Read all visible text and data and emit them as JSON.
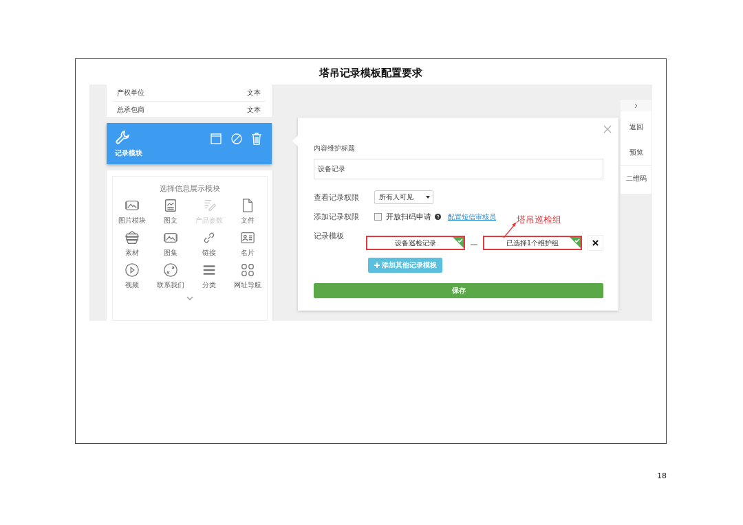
{
  "document": {
    "title": "塔吊记录模板配置要求",
    "page_number": "18"
  },
  "field_list": [
    {
      "name": "产权单位",
      "type": "文本"
    },
    {
      "name": "总承包商",
      "type": "文本"
    }
  ],
  "active_module": {
    "label": "记录模块"
  },
  "module_picker": {
    "title": "选择信息展示模块",
    "items": [
      {
        "label": "图片模块",
        "kind": "image",
        "disabled": false
      },
      {
        "label": "图文",
        "kind": "article",
        "disabled": false
      },
      {
        "label": "产品参数",
        "kind": "edit",
        "disabled": true
      },
      {
        "label": "文件",
        "kind": "file",
        "disabled": false
      },
      {
        "label": "素材",
        "kind": "layers",
        "disabled": false
      },
      {
        "label": "图集",
        "kind": "image",
        "disabled": false
      },
      {
        "label": "链接",
        "kind": "link",
        "disabled": false
      },
      {
        "label": "名片",
        "kind": "card",
        "disabled": false
      },
      {
        "label": "视频",
        "kind": "video",
        "disabled": false
      },
      {
        "label": "联系我们",
        "kind": "contact",
        "disabled": false
      },
      {
        "label": "分类",
        "kind": "list",
        "disabled": false
      },
      {
        "label": "网址导航",
        "kind": "grid",
        "disabled": false
      }
    ]
  },
  "dialog": {
    "title_label": "内容维护标题",
    "title_value": "设备记录",
    "view_permission": {
      "label": "查看记录权限",
      "value": "所有人可见"
    },
    "add_permission": {
      "label": "添加记录权限",
      "option": "开放扫码申请",
      "checked": false,
      "link": "配置短信审核员"
    },
    "template": {
      "label": "记录模板",
      "record": {
        "value": "设备巡检记录",
        "checked": true
      },
      "group": {
        "value": "已选择1个维护组",
        "checked": true
      },
      "add_button": "添加其他记录模板"
    },
    "save_button": "保存"
  },
  "annotation": {
    "text": "塔吊巡检组"
  },
  "side_nav": {
    "items": [
      "返回",
      "预览",
      "二维码"
    ]
  }
}
